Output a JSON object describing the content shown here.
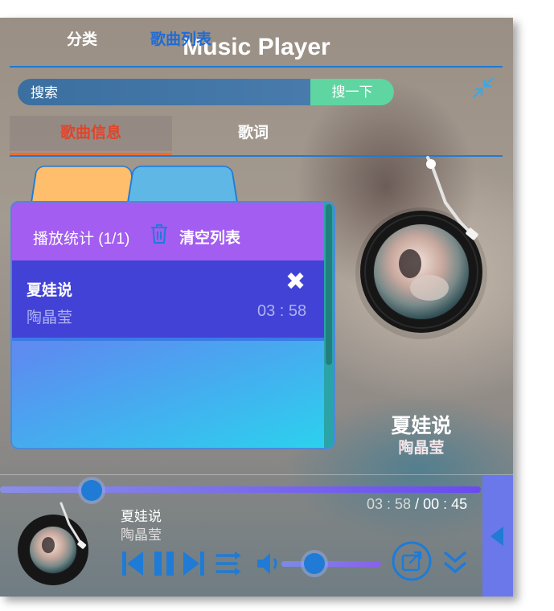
{
  "app": {
    "title": "Music Player"
  },
  "search": {
    "placeholder": "搜索",
    "button_label": "搜一下"
  },
  "tabs": [
    {
      "label": "歌曲信息",
      "active": true
    },
    {
      "label": "歌词",
      "active": false
    }
  ],
  "subtabs": [
    {
      "label": "分类"
    },
    {
      "label": "歌曲列表",
      "active": true
    }
  ],
  "playlist": {
    "stats_label": "播放统计 (1/1)",
    "clear_label": "清空列表",
    "songs": [
      {
        "name": "夏娃说",
        "artist": "陶晶莹",
        "duration": "03 : 58"
      }
    ]
  },
  "now_playing": {
    "title": "夏娃说",
    "artist": "陶晶莹"
  },
  "player": {
    "song_title": "夏娃说",
    "artist": "陶晶莹",
    "current_time": "03 : 58",
    "separator": " / ",
    "total_time": "00 : 45",
    "progress_fraction": 0.19,
    "volume_fraction": 0.33
  },
  "colors": {
    "accent_blue": "#1f7bd6",
    "active_tab_text": "#e0452a",
    "tab_underline": "#f06c2b",
    "search_button": "#5fd6a2",
    "playlist_header": "#a35df0",
    "selected_row": "#4242d6",
    "side_button": "#6b78ea"
  }
}
